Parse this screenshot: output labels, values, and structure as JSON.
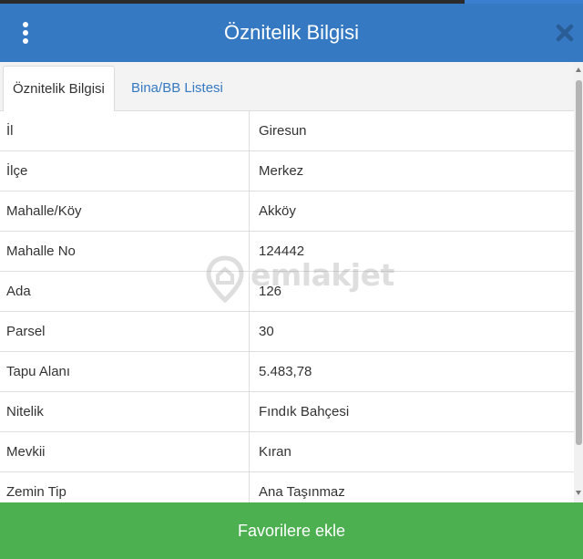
{
  "header": {
    "title": "Öznitelik Bilgisi",
    "menu_icon": "kebab-vertical-icon",
    "close_icon": "close-icon",
    "background_color": "#3579c2"
  },
  "tabs": [
    {
      "label": "Öznitelik Bilgisi",
      "active": true
    },
    {
      "label": "Bina/BB Listesi",
      "active": false
    }
  ],
  "attributes": [
    {
      "key": "İl",
      "value": "Giresun"
    },
    {
      "key": "İlçe",
      "value": "Merkez"
    },
    {
      "key": "Mahalle/Köy",
      "value": "Akköy"
    },
    {
      "key": "Mahalle No",
      "value": "124442"
    },
    {
      "key": "Ada",
      "value": "126"
    },
    {
      "key": "Parsel",
      "value": "30"
    },
    {
      "key": "Tapu Alanı",
      "value": "5.483,78"
    },
    {
      "key": "Nitelik",
      "value": "Fındık Bahçesi"
    },
    {
      "key": "Mevkii",
      "value": "Kıran"
    },
    {
      "key": "Zemin Tip",
      "value": "Ana Taşınmaz"
    }
  ],
  "watermark": {
    "text": "emlakjet",
    "icon": "location-pin-icon"
  },
  "footer": {
    "button_label": "Favorilere ekle",
    "background_color": "#4caf50"
  }
}
